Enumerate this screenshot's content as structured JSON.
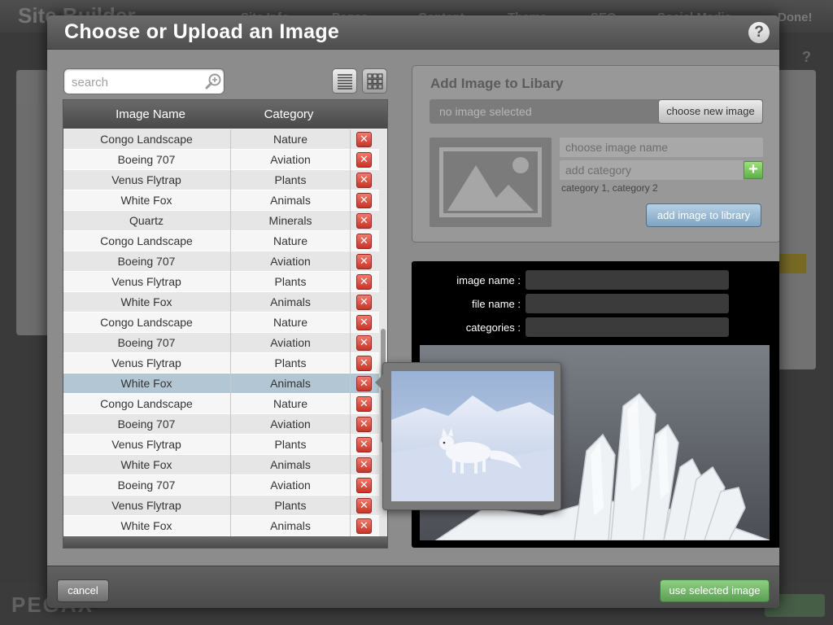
{
  "background_app": {
    "logo": "Site Builder",
    "tabs": [
      "Site Info",
      "Pages",
      "Content",
      "Theme",
      "SEO",
      "Social Media",
      "Done!"
    ],
    "footer_logo": "PEGAX"
  },
  "modal": {
    "title": "Choose or Upload an Image",
    "help_label": "?"
  },
  "search": {
    "placeholder": "search",
    "value": ""
  },
  "table": {
    "columns": [
      "Image Name",
      "Category"
    ],
    "rows": [
      {
        "name": "Congo Landscape",
        "category": "Nature"
      },
      {
        "name": "Boeing 707",
        "category": "Aviation"
      },
      {
        "name": "Venus Flytrap",
        "category": "Plants"
      },
      {
        "name": "White Fox",
        "category": "Animals"
      },
      {
        "name": "Quartz",
        "category": "Minerals"
      },
      {
        "name": "Congo Landscape",
        "category": "Nature"
      },
      {
        "name": "Boeing 707",
        "category": "Aviation"
      },
      {
        "name": "Venus Flytrap",
        "category": "Plants"
      },
      {
        "name": "White Fox",
        "category": "Animals"
      },
      {
        "name": "Congo Landscape",
        "category": "Nature"
      },
      {
        "name": "Boeing 707",
        "category": "Aviation"
      },
      {
        "name": "Venus Flytrap",
        "category": "Plants"
      },
      {
        "name": "White Fox",
        "category": "Animals",
        "selected": true
      },
      {
        "name": "Congo Landscape",
        "category": "Nature"
      },
      {
        "name": "Boeing 707",
        "category": "Aviation"
      },
      {
        "name": "Venus Flytrap",
        "category": "Plants"
      },
      {
        "name": "White Fox",
        "category": "Animals"
      },
      {
        "name": "Boeing 707",
        "category": "Aviation"
      },
      {
        "name": "Venus Flytrap",
        "category": "Plants"
      },
      {
        "name": "White Fox",
        "category": "Animals"
      }
    ],
    "delete_icon": "close-icon"
  },
  "add_panel": {
    "title": "Add Image to Libary",
    "file_status": "no image selected",
    "choose_button": "choose new image",
    "name_placeholder": "choose image name",
    "category_placeholder": "add category",
    "add_category_label": "+",
    "category_hint": "category 1, category 2",
    "add_button": "add image to library"
  },
  "info_panel": {
    "labels": {
      "image_name": "image name :",
      "file_name": "file name :",
      "categories": "categories :"
    }
  },
  "footer": {
    "cancel": "cancel",
    "use_selected": "use selected image"
  },
  "colors": {
    "selected_row": "#b3c6d4",
    "delete_red": "#d9473a",
    "add_green": "#6cbf54",
    "primary_blue": "#8fb2ce",
    "confirm_green": "#6fb364"
  }
}
